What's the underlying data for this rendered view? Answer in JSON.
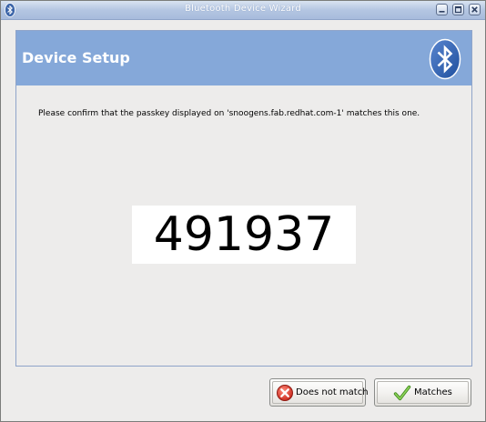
{
  "window": {
    "title": "Bluetooth Device Wizard",
    "app_icon": "bluetooth-icon",
    "controls": [
      "minimize-icon",
      "maximize-icon",
      "close-icon"
    ]
  },
  "header": {
    "title": "Device Setup",
    "logo_icon": "bluetooth-logo-icon",
    "band_color": "#85a8d9"
  },
  "main": {
    "instruction": "Please confirm that the passkey displayed on 'snoogens.fab.redhat.com-1' matches this one.",
    "passkey": "491937"
  },
  "buttons": {
    "no_match": {
      "label": "Does not match",
      "icon": "red-x-icon",
      "icon_color": "#d63a2b"
    },
    "match": {
      "label": "Matches",
      "icon": "green-checkmark-icon",
      "icon_color": "#5aa829"
    }
  }
}
